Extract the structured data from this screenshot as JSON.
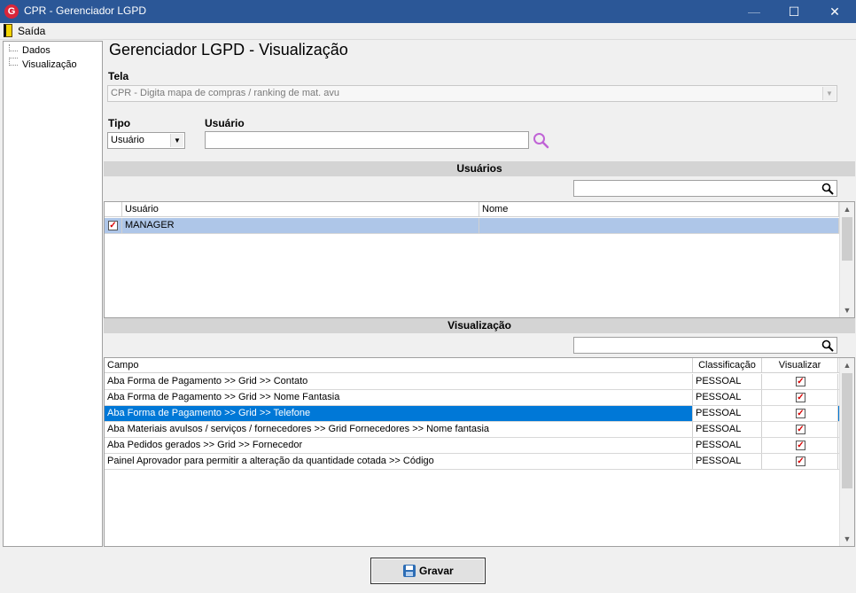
{
  "window": {
    "title": "CPR - Gerenciador LGPD",
    "minimize_glyph": "—",
    "maximize_glyph": "☐",
    "close_glyph": "✕",
    "app_icon_letter": "G"
  },
  "menu": {
    "exit_label": "Saída"
  },
  "tree": {
    "items": [
      {
        "label": "Dados"
      },
      {
        "label": "Visualização"
      }
    ]
  },
  "page": {
    "title": "Gerenciador LGPD - Visualização"
  },
  "tela": {
    "label": "Tela",
    "value": "CPR - Digita mapa de compras / ranking de mat. avu"
  },
  "tipo": {
    "label": "Tipo",
    "value": "Usuário"
  },
  "usuario": {
    "label": "Usuário",
    "value": ""
  },
  "usuarios_section": {
    "title": "Usuários",
    "search_value": "",
    "columns": {
      "usuario": "Usuário",
      "nome": "Nome"
    },
    "rows": [
      {
        "checked": true,
        "usuario": "MANAGER",
        "nome": ""
      }
    ]
  },
  "visualizacao_section": {
    "title": "Visualização",
    "search_value": "",
    "columns": {
      "campo": "Campo",
      "classificacao": "Classificação",
      "visualizar": "Visualizar"
    },
    "rows": [
      {
        "campo": "Aba Forma de Pagamento >> Grid >> Contato",
        "classificacao": "PESSOAL",
        "visualizar": true
      },
      {
        "campo": "Aba Forma de Pagamento >> Grid >> Nome Fantasia",
        "classificacao": "PESSOAL",
        "visualizar": true
      },
      {
        "campo": "Aba Forma de Pagamento >> Grid >> Telefone",
        "classificacao": "PESSOAL",
        "visualizar": true,
        "selected": true
      },
      {
        "campo": "Aba Materiais avulsos / serviços / fornecedores >> Grid Fornecedores >> Nome fantasia",
        "classificacao": "PESSOAL",
        "visualizar": true
      },
      {
        "campo": "Aba Pedidos gerados >> Grid >> Fornecedor",
        "classificacao": "PESSOAL",
        "visualizar": true
      },
      {
        "campo": "Painel Aprovador para permitir a alteração da quantidade cotada >> Código",
        "classificacao": "PESSOAL",
        "visualizar": true
      }
    ]
  },
  "actions": {
    "save_label": "Gravar"
  },
  "colors": {
    "titlebar": "#2b5797",
    "selection_blue": "#0078d7",
    "selection_light": "#aec6e8",
    "checkmark_red": "#d60000",
    "search_icon": "#c063d6"
  },
  "icons": {
    "app": "app-logo-icon",
    "exit": "door-exit-icon",
    "magnifier": "search-icon",
    "save": "floppy-disk-icon",
    "check": "checkbox-checked-icon"
  }
}
